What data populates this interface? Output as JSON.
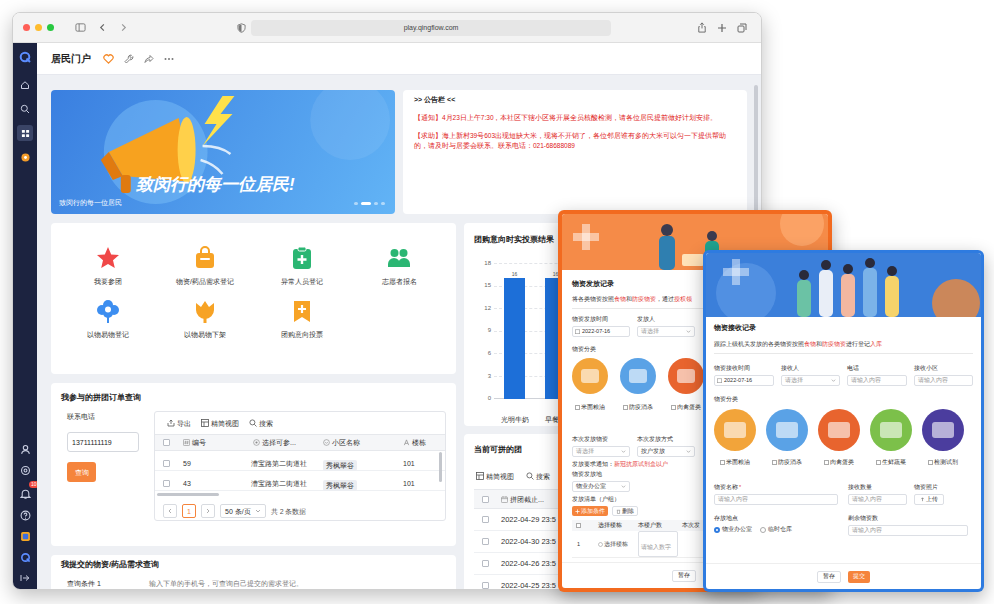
{
  "browser": {
    "url": "play.qingflow.com"
  },
  "sidebar": {
    "nav": [
      {
        "selected": false
      },
      {
        "selected": false
      },
      {
        "selected": true
      },
      {
        "selected": false
      }
    ],
    "badge": "10"
  },
  "app": {
    "title": "居民门户"
  },
  "banner": {
    "headline": "致闵行的每一位居民!",
    "caption": "致闵行的每一位居民",
    "slides": [
      {
        "selected": false
      },
      {
        "selected": true
      },
      {
        "selected": false
      },
      {
        "selected": false
      }
    ]
  },
  "notice": {
    "title": ">> 公告栏 <<",
    "items": [
      "【通知】4月23日上午7:30，本社区下辖小区将开展全员核酸检测，请各位居民提前做好计划安排。",
      "【求助】海上新村39号603出现短缺大米，现将不开销了，各位邻居谁有多的大米可以匀一下提供帮助的，请及时与居委会联系。联系电话：021-68688089"
    ]
  },
  "shortcuts": [
    {
      "label": "我要参团",
      "color": "#f04848"
    },
    {
      "label": "物资/药品需求登记",
      "color": "#f7a325"
    },
    {
      "label": "异常人员登记",
      "color": "#2bb673"
    },
    {
      "label": "志愿者报名",
      "color": "#2bb673"
    },
    {
      "label": "以物易物登记",
      "color": "#3d8ef0"
    },
    {
      "label": "以物易物下架",
      "color": "#f7a325"
    },
    {
      "label": "团购意向投票",
      "color": "#f7a325"
    }
  ],
  "vote_chart": {
    "title": "团购意向时实投票结果",
    "ticks": [
      "18",
      "15",
      "12",
      "9",
      "6",
      "3",
      "0"
    ],
    "categories": [
      "光明牛奶",
      "早餐面"
    ],
    "series": [
      {
        "values": [
          16,
          16
        ],
        "value_labels": [
          "16",
          "16"
        ]
      }
    ]
  },
  "order_query": {
    "title": "我参与的拼团订单查询",
    "phone_label": "联系电话",
    "phone_value": "13711111119",
    "button": "查询",
    "toolbar": [
      "导出",
      "精简视图",
      "搜索"
    ],
    "columns": [
      "编号",
      "选择可参...",
      "小区名称",
      "楼栋"
    ],
    "rows": [
      [
        "59",
        "漕宝路第二街道社",
        "秀枫翠谷",
        "101"
      ],
      [
        "43",
        "漕宝路第二街道社",
        "秀枫翠谷",
        "101"
      ]
    ],
    "page": {
      "label": "1",
      "selected": true
    },
    "page_size": "50 条/页",
    "total": "共 2 条数据"
  },
  "demand_query": {
    "title": "我提交的物资/药品需求查询",
    "condition": "查询条件 1",
    "hint": "输入下单的手机号，可查询自己提交的需求登记。"
  },
  "group_list": {
    "title": "当前可拼的团",
    "toolbar": [
      "精简视图",
      "搜索"
    ],
    "column": "拼团截止...",
    "rows": [
      "2022-04-29 23:5",
      "2022-04-30 23:5",
      "2022-04-26 23:5",
      "2022-04-25 23:5"
    ]
  },
  "issue_form": {
    "title": "物资发放记录",
    "description": [
      {
        "text": "将各类物资按照",
        "color": "#333333"
      },
      {
        "text": "食物",
        "color": "#e53935"
      },
      {
        "text": "和",
        "color": "#333333"
      },
      {
        "text": "防疫物资",
        "color": "#e53935"
      },
      {
        "text": "，通过",
        "color": "#333333"
      },
      {
        "text": "授权领",
        "color": "#e53935"
      }
    ],
    "fields_top": [
      {
        "label": "物资发放时间",
        "value": "2022-07-16"
      },
      {
        "label": "发放人",
        "placeholder": "请选择"
      }
    ],
    "category_label": "物资分类",
    "categories": [
      {
        "label": "米面粮油",
        "checked": false,
        "color": "#f2a43a"
      },
      {
        "label": "防疫消杀",
        "checked": false,
        "color": "#5aa2e6"
      },
      {
        "label": "肉禽蛋类",
        "checked": false,
        "color": "#e8642e"
      }
    ],
    "fields_mid": [
      {
        "label": "本次发放物资",
        "placeholder": "请选择"
      },
      {
        "label": "本次发放方式",
        "value": "按户发放"
      }
    ],
    "notice_label": "发放要求通知：",
    "notice_text": "新冠抗原试剂盒以户",
    "place_label": "物资发放地",
    "place_value": "物业办公室",
    "list_label": "发放清单（户组）",
    "add_button": "添加条件",
    "delete_button": "删除",
    "columns": [
      "选择楼栋",
      "本楼户数",
      "本次发"
    ],
    "row": {
      "index": "1",
      "building": "选择楼栋",
      "households": "请输入数字"
    },
    "save": "暂存"
  },
  "receive_form": {
    "title": "物资接收记录",
    "description": [
      {
        "text": "跟踪上级机关发放的各类物资按照",
        "color": "#333333"
      },
      {
        "text": "食物",
        "color": "#e53935"
      },
      {
        "text": "和",
        "color": "#333333"
      },
      {
        "text": "防疫物资",
        "color": "#e53935"
      },
      {
        "text": "进行登记",
        "color": "#333333"
      },
      {
        "text": "入库",
        "color": "#e53935"
      }
    ],
    "fields_top": [
      {
        "label": "物资接收时间",
        "value": "2022-07-16"
      },
      {
        "label": "接收人",
        "placeholder": "请选择"
      },
      {
        "label": "电话",
        "placeholder": "请输入内容"
      },
      {
        "label": "接收小区",
        "placeholder": "请输入内容"
      }
    ],
    "category_label": "物资分类",
    "categories": [
      {
        "label": "米面粮油",
        "checked": false,
        "color": "#f2a43a"
      },
      {
        "label": "防疫消杀",
        "checked": false,
        "color": "#5aa2e6"
      },
      {
        "label": "肉禽蛋类",
        "checked": false,
        "color": "#e8642e"
      },
      {
        "label": "生鲜蔬菜",
        "checked": false,
        "color": "#7cc04a"
      },
      {
        "label": "检测试剂",
        "checked": false,
        "color": "#4b3d9e"
      }
    ],
    "name_label": "物资名称",
    "required": "*",
    "name_placeholder": "请输入内容",
    "qty_label": "接收数量",
    "qty_placeholder": "请输入内容",
    "photo_label": "物资照片",
    "upload": "上传",
    "storage_label": "存放地点",
    "storage_options": [
      {
        "label": "物业办公室",
        "selected": true
      },
      {
        "label": "临时仓库",
        "selected": false
      }
    ],
    "remain_label": "剩余物资数",
    "remain_placeholder": "请输入内容",
    "buttons": [
      {
        "label": "暂存",
        "kind": "default"
      },
      {
        "label": "提交",
        "kind": "primary"
      }
    ]
  }
}
